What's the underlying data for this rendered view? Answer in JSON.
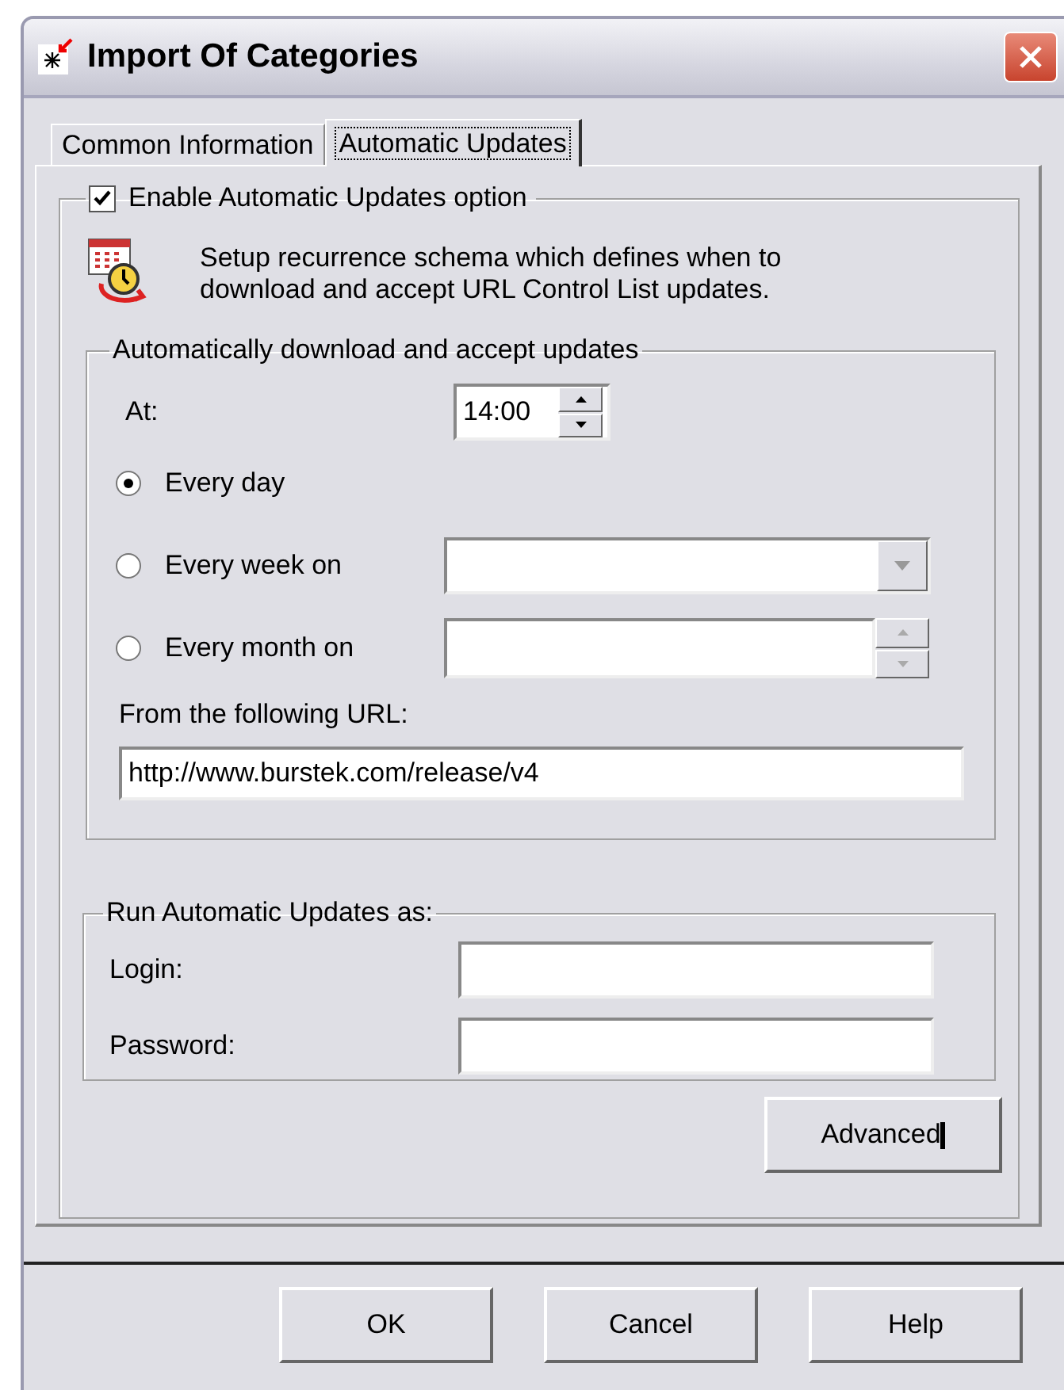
{
  "window": {
    "title": "Import Of Categories"
  },
  "tabs": [
    {
      "label": "Common Information",
      "selected": false
    },
    {
      "label": "Automatic Updates",
      "selected": true
    }
  ],
  "enable": {
    "label": "Enable Automatic Updates option",
    "checked": true
  },
  "description": "Setup recurrence schema which defines when to download and accept URL Control List updates.",
  "schedule": {
    "title": "Automatically download and accept updates",
    "at": {
      "label": "At:",
      "value": "14:00"
    },
    "options": [
      {
        "label": "Every day",
        "selected": true,
        "kind": "none"
      },
      {
        "label": "Every week on",
        "selected": false,
        "kind": "combo"
      },
      {
        "label": "Every month on",
        "selected": false,
        "kind": "spin"
      }
    ],
    "url": {
      "label": "From the following URL:",
      "value": "http://www.burstek.com/release/v4"
    }
  },
  "run_as": {
    "title": "Run Automatic Updates as:",
    "fields": [
      {
        "label": "Login:"
      },
      {
        "label": "Password:"
      }
    ]
  },
  "advanced_button": "Advanced",
  "buttons": [
    "OK",
    "Cancel",
    "Help"
  ]
}
